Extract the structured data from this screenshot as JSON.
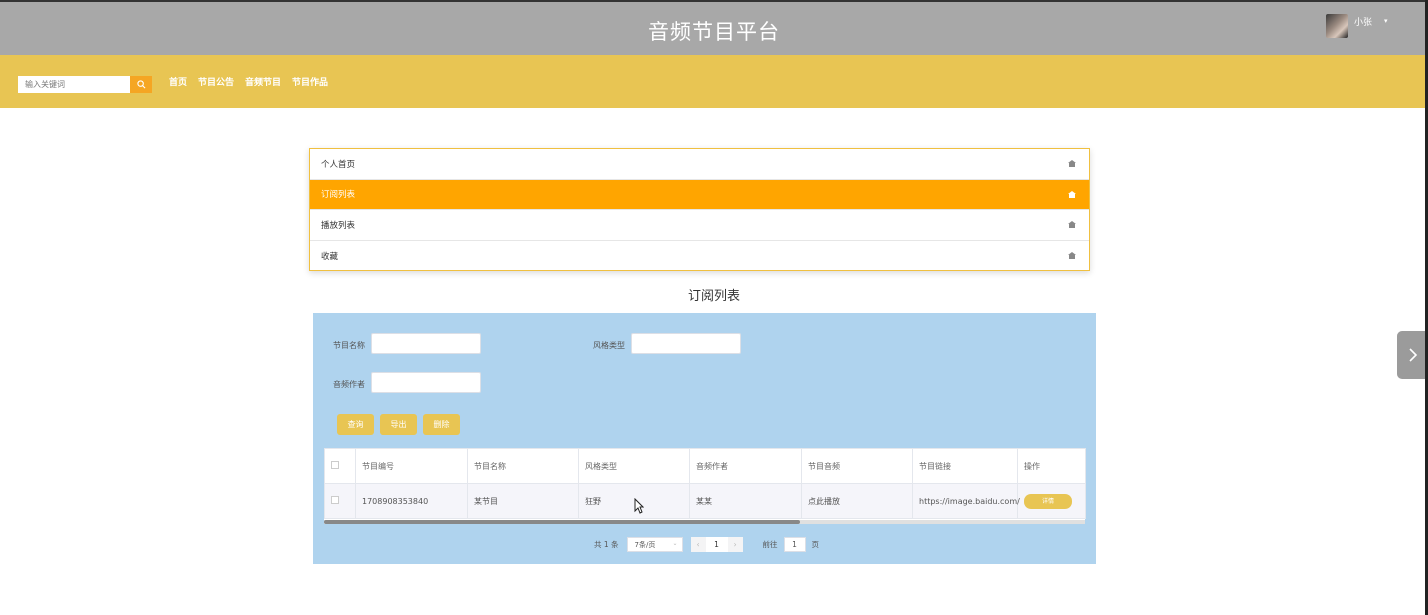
{
  "header": {
    "site_title": "音频节目平台",
    "user_name": "小张",
    "caret": "▾"
  },
  "nav": {
    "search_placeholder": "输入关键词",
    "links": [
      "首页",
      "节目公告",
      "音频节目",
      "节目作品"
    ]
  },
  "menu": {
    "items": [
      {
        "label": "个人首页",
        "active": false
      },
      {
        "label": "订阅列表",
        "active": true
      },
      {
        "label": "播放列表",
        "active": false
      },
      {
        "label": "收藏",
        "active": false
      }
    ]
  },
  "section_title": "订阅列表",
  "filters": {
    "program_name_label": "节目名称",
    "style_type_label": "风格类型",
    "audio_author_label": "音频作者"
  },
  "buttons": {
    "query": "查询",
    "export": "导出",
    "delete": "删除"
  },
  "table": {
    "headers": [
      "节目编号",
      "节目名称",
      "风格类型",
      "音频作者",
      "节目音频",
      "节目链接",
      "操作"
    ],
    "rows": [
      {
        "program_id": "1708908353840",
        "program_name": "某节目",
        "style_type": "狂野",
        "audio_author": "某某",
        "program_audio": "点此播放",
        "program_link": "https://image.baidu.com/",
        "action": "详情"
      }
    ]
  },
  "pagination": {
    "total": "共 1 条",
    "page_size": "7条/页",
    "current_page": "1",
    "goto_label": "前往",
    "goto_value": "1",
    "page_suffix": "页"
  },
  "colors": {
    "topbar": "#a8a8a8",
    "navbar": "#e8c553",
    "accent": "#ffa500",
    "panel": "#afd3ee",
    "button": "#e8c553"
  }
}
